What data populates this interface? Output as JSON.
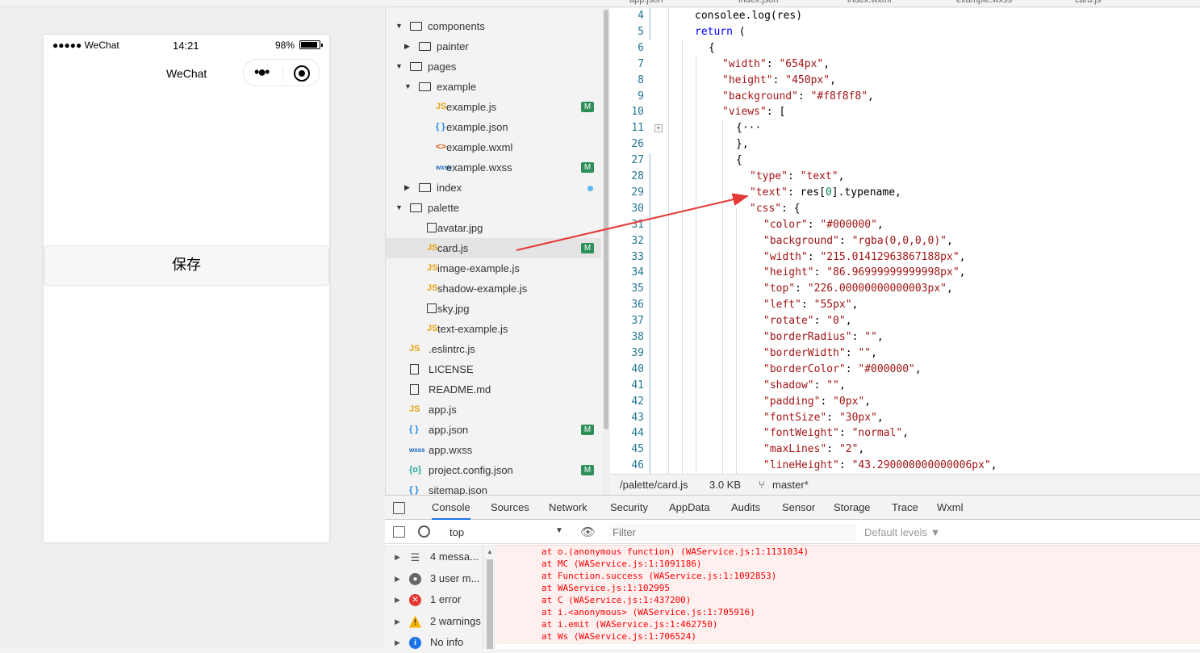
{
  "top_tabs": [
    "app.json",
    "index.json",
    "index.wxml",
    "example.wxss",
    "card.js"
  ],
  "simulator": {
    "carrier": "●●●●● WeChat",
    "time": "14:21",
    "battery": "98%",
    "nav_title": "WeChat",
    "save_label": "保存"
  },
  "tree": [
    {
      "label": "components",
      "type": "folder",
      "open": true,
      "depth": 0
    },
    {
      "label": "painter",
      "type": "folder",
      "open": false,
      "depth": 1
    },
    {
      "label": "pages",
      "type": "folder",
      "open": true,
      "depth": 0
    },
    {
      "label": "example",
      "type": "folder",
      "open": true,
      "depth": 1
    },
    {
      "label": "example.js",
      "type": "js",
      "depth": 2,
      "badge": "M"
    },
    {
      "label": "example.json",
      "type": "json",
      "depth": 2
    },
    {
      "label": "example.wxml",
      "type": "wxml",
      "depth": 2
    },
    {
      "label": "example.wxss",
      "type": "wxss",
      "depth": 2,
      "badge": "M"
    },
    {
      "label": "index",
      "type": "folder",
      "open": false,
      "depth": 1,
      "dot": true
    },
    {
      "label": "palette",
      "type": "folder",
      "open": true,
      "depth": 0
    },
    {
      "label": "avatar.jpg",
      "type": "img",
      "depth": 1
    },
    {
      "label": "card.js",
      "type": "js",
      "depth": 1,
      "badge": "M",
      "selected": true
    },
    {
      "label": "image-example.js",
      "type": "js",
      "depth": 1
    },
    {
      "label": "shadow-example.js",
      "type": "js",
      "depth": 1
    },
    {
      "label": "sky.jpg",
      "type": "img",
      "depth": 1
    },
    {
      "label": "text-example.js",
      "type": "js",
      "depth": 1
    },
    {
      "label": ".eslintrc.js",
      "type": "js",
      "depth": 0
    },
    {
      "label": "LICENSE",
      "type": "file",
      "depth": 0
    },
    {
      "label": "README.md",
      "type": "file",
      "depth": 0
    },
    {
      "label": "app.js",
      "type": "js",
      "depth": 0
    },
    {
      "label": "app.json",
      "type": "json",
      "depth": 0,
      "badge": "M"
    },
    {
      "label": "app.wxss",
      "type": "wxss",
      "depth": 0
    },
    {
      "label": "project.config.json",
      "type": "config",
      "depth": 0,
      "badge": "M"
    },
    {
      "label": "sitemap.json",
      "type": "json",
      "depth": 0
    }
  ],
  "editor": {
    "lines": [
      {
        "n": "4",
        "html": "consolee.log(res)",
        "indent": 0
      },
      {
        "n": "5",
        "html": "<span class='k'>return</span> (",
        "indent": 0
      },
      {
        "n": "6",
        "html": "{",
        "indent": 1
      },
      {
        "n": "7",
        "html": "<span class='s'>\"width\"</span>: <span class='s'>\"654px\"</span>,",
        "indent": 2
      },
      {
        "n": "8",
        "html": "<span class='s'>\"height\"</span>: <span class='s'>\"450px\"</span>,",
        "indent": 2
      },
      {
        "n": "9",
        "html": "<span class='s'>\"background\"</span>: <span class='s'>\"#f8f8f8\"</span>,",
        "indent": 2
      },
      {
        "n": "10",
        "html": "<span class='s'>\"views\"</span>: [",
        "indent": 2
      },
      {
        "n": "11",
        "html": "{···",
        "indent": 3
      },
      {
        "n": "26",
        "html": "},",
        "indent": 3
      },
      {
        "n": "27",
        "html": "{",
        "indent": 3
      },
      {
        "n": "28",
        "html": "<span class='s'>\"type\"</span>: <span class='s'>\"text\"</span>,",
        "indent": 4
      },
      {
        "n": "29",
        "html": "<span class='s'>\"text\"</span>: res[<span class='num'>0</span>].typename,",
        "indent": 4
      },
      {
        "n": "30",
        "html": "<span class='s'>\"css\"</span>: {",
        "indent": 4
      },
      {
        "n": "31",
        "html": "<span class='s'>\"color\"</span>: <span class='s'>\"#000000\"</span>,",
        "indent": 5
      },
      {
        "n": "32",
        "html": "<span class='s'>\"background\"</span>: <span class='s'>\"rgba(0,0,0,0)\"</span>,",
        "indent": 5
      },
      {
        "n": "33",
        "html": "<span class='s'>\"width\"</span>: <span class='s'>\"215.01412963867188px\"</span>,",
        "indent": 5
      },
      {
        "n": "34",
        "html": "<span class='s'>\"height\"</span>: <span class='s'>\"86.96999999999998px\"</span>,",
        "indent": 5
      },
      {
        "n": "35",
        "html": "<span class='s'>\"top\"</span>: <span class='s'>\"226.00000000000003px\"</span>,",
        "indent": 5
      },
      {
        "n": "36",
        "html": "<span class='s'>\"left\"</span>: <span class='s'>\"55px\"</span>,",
        "indent": 5
      },
      {
        "n": "37",
        "html": "<span class='s'>\"rotate\"</span>: <span class='s'>\"0\"</span>,",
        "indent": 5
      },
      {
        "n": "38",
        "html": "<span class='s'>\"borderRadius\"</span>: <span class='s'>\"\"</span>,",
        "indent": 5
      },
      {
        "n": "39",
        "html": "<span class='s'>\"borderWidth\"</span>: <span class='s'>\"\"</span>,",
        "indent": 5
      },
      {
        "n": "40",
        "html": "<span class='s'>\"borderColor\"</span>: <span class='s'>\"#000000\"</span>,",
        "indent": 5
      },
      {
        "n": "41",
        "html": "<span class='s'>\"shadow\"</span>: <span class='s'>\"\"</span>,",
        "indent": 5
      },
      {
        "n": "42",
        "html": "<span class='s'>\"padding\"</span>: <span class='s'>\"0px\"</span>,",
        "indent": 5
      },
      {
        "n": "43",
        "html": "<span class='s'>\"fontSize\"</span>: <span class='s'>\"30px\"</span>,",
        "indent": 5
      },
      {
        "n": "44",
        "html": "<span class='s'>\"fontWeight\"</span>: <span class='s'>\"normal\"</span>,",
        "indent": 5
      },
      {
        "n": "45",
        "html": "<span class='s'>\"maxLines\"</span>: <span class='s'>\"2\"</span>,",
        "indent": 5
      },
      {
        "n": "46",
        "html": "<span class='s'>\"lineHeight\"</span>: <span class='s'>\"43.290000000000006px\"</span>,",
        "indent": 5
      }
    ],
    "status": {
      "path": "/palette/card.js",
      "size": "3.0 KB",
      "branch": "master*"
    }
  },
  "devtools": {
    "tabs": [
      "Console",
      "Sources",
      "Network",
      "Security",
      "AppData",
      "Audits",
      "Sensor",
      "Storage",
      "Trace",
      "Wxml"
    ],
    "active_tab": "Console",
    "context": "top",
    "filter_placeholder": "Filter",
    "levels": "Default levels ▼",
    "sidebar": [
      {
        "label": "4 messa...",
        "icon": "list-icon"
      },
      {
        "label": "3 user m...",
        "icon": "user-icon"
      },
      {
        "label": "1 error",
        "icon": "error-icon"
      },
      {
        "label": "2 warnings",
        "icon": "warning-icon"
      },
      {
        "label": "No info",
        "icon": "info-icon"
      }
    ],
    "console_lines": [
      "at o.(anonymous function) (WAService.js:1:1131034)",
      "at MC (WAService.js:1:1091186)",
      "at Function.success (WAService.js:1:1092853)",
      "at WAService.js:1:102995",
      "at C (WAService.js:1:437200)",
      "at i.<anonymous> (WAService.js:1:705916)",
      "at i.emit (WAService.js:1:462750)",
      "at Ws (WAService.js:1:706524)"
    ]
  },
  "colors": {
    "badge": "#2e8f5a",
    "arrow": "#e53935",
    "error_bg": "#fff0f0",
    "error_text": "#ff0000"
  }
}
